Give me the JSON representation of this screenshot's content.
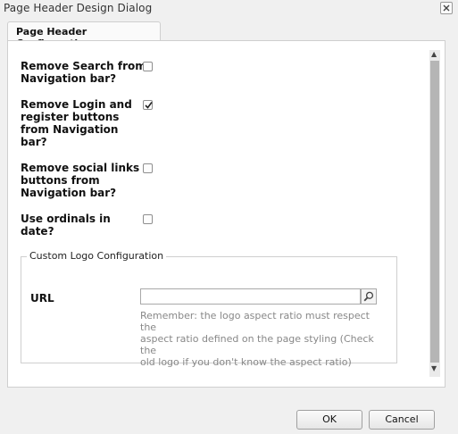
{
  "dialog": {
    "title": "Page Header Design Dialog",
    "close_icon": "close-icon"
  },
  "tabs": [
    {
      "label": "Page Header Configuration",
      "active": true
    }
  ],
  "options": [
    {
      "label_lines": [
        "Remove Search from",
        "Navigation bar?"
      ],
      "checked": false
    },
    {
      "label_lines": [
        "Remove Login and",
        "register buttons",
        "from Navigation",
        "bar?"
      ],
      "checked": true
    },
    {
      "label_lines": [
        "Remove social links",
        "buttons from",
        "Navigation bar?"
      ],
      "checked": false
    },
    {
      "label_lines": [
        "Use ordinals in",
        "date?"
      ],
      "checked": false
    }
  ],
  "custom_logo": {
    "legend": "Custom Logo Configuration",
    "url_label": "URL",
    "url_value": "",
    "search_icon": "magnifier-icon",
    "hint_lines": [
      "Remember: the logo aspect ratio must respect the",
      "aspect ratio defined on the page styling (Check the",
      "old logo if you don't know the aspect ratio)"
    ]
  },
  "buttons": {
    "ok": "OK",
    "cancel": "Cancel"
  }
}
